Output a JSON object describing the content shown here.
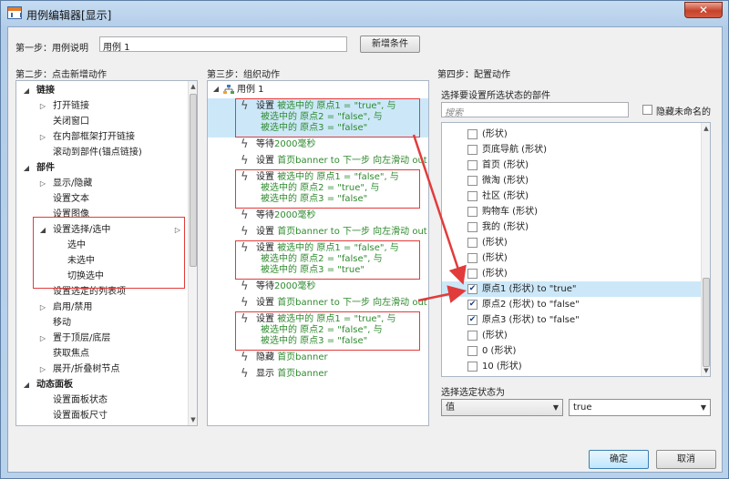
{
  "window": {
    "title": "用例编辑器[显示]",
    "close_glyph": "✕"
  },
  "step1": {
    "label": "第一步：用例说明",
    "case_name": "用例 1",
    "add_condition": "新增条件"
  },
  "step2": {
    "label": "第二步：点击新增动作",
    "items": [
      {
        "text": "链接",
        "kind": "group"
      },
      {
        "text": "打开链接",
        "kind": "child",
        "has_children": true
      },
      {
        "text": "关闭窗口",
        "kind": "child"
      },
      {
        "text": "在内部框架打开链接",
        "kind": "child",
        "has_children": true
      },
      {
        "text": "滚动到部件(锚点链接)",
        "kind": "child"
      },
      {
        "text": "部件",
        "kind": "group"
      },
      {
        "text": "显示/隐藏",
        "kind": "child",
        "has_children": true
      },
      {
        "text": "设置文本",
        "kind": "child"
      },
      {
        "text": "设置图像",
        "kind": "child"
      },
      {
        "text": "设置选择/选中",
        "kind": "child",
        "expanded": true
      },
      {
        "text": "选中",
        "kind": "grandchild"
      },
      {
        "text": "未选中",
        "kind": "grandchild"
      },
      {
        "text": "切换选中",
        "kind": "grandchild"
      },
      {
        "text": "设置选定的列表项",
        "kind": "child"
      },
      {
        "text": "启用/禁用",
        "kind": "child",
        "has_children": true
      },
      {
        "text": "移动",
        "kind": "child"
      },
      {
        "text": "置于顶层/底层",
        "kind": "child",
        "has_children": true
      },
      {
        "text": "获取焦点",
        "kind": "child"
      },
      {
        "text": "展开/折叠树节点",
        "kind": "child",
        "has_children": true
      },
      {
        "text": "动态面板",
        "kind": "group"
      },
      {
        "text": "设置面板状态",
        "kind": "child"
      },
      {
        "text": "设置面板尺寸",
        "kind": "child"
      }
    ]
  },
  "step3": {
    "label": "第三步：组织动作",
    "case_node": "用例 1",
    "actions": [
      {
        "lines": [
          [
            "设置 ",
            "被选中的 原点1 = \"true\", 与"
          ],
          [
            "",
            "被选中的 原点2 = \"false\", 与"
          ],
          [
            "",
            "被选中的 原点3 = \"false\""
          ]
        ],
        "selected": true
      },
      {
        "lines": [
          [
            "等待",
            "2000毫秒"
          ]
        ]
      },
      {
        "lines": [
          [
            "设置 ",
            "首页banner to 下一步 向左滑动 out 5("
          ]
        ]
      },
      {
        "lines": [
          [
            "设置 ",
            "被选中的 原点1 = \"false\", 与"
          ],
          [
            "",
            "被选中的 原点2 = \"true\", 与"
          ],
          [
            "",
            "被选中的 原点3 = \"false\""
          ]
        ]
      },
      {
        "lines": [
          [
            "等待",
            "2000毫秒"
          ]
        ]
      },
      {
        "lines": [
          [
            "设置 ",
            "首页banner to 下一步 向左滑动 out 5("
          ]
        ]
      },
      {
        "lines": [
          [
            "设置 ",
            "被选中的 原点1 = \"false\", 与"
          ],
          [
            "",
            "被选中的 原点2 = \"false\", 与"
          ],
          [
            "",
            "被选中的 原点3 = \"true\""
          ]
        ]
      },
      {
        "lines": [
          [
            "等待",
            "2000毫秒"
          ]
        ]
      },
      {
        "lines": [
          [
            "设置 ",
            "首页banner to 下一步 向左滑动 out 5("
          ]
        ]
      },
      {
        "lines": [
          [
            "设置 ",
            "被选中的 原点1 = \"true\", 与"
          ],
          [
            "",
            "被选中的 原点2 = \"false\", 与"
          ],
          [
            "",
            "被选中的 原点3 = \"false\""
          ]
        ]
      },
      {
        "lines": [
          [
            "隐藏 ",
            "首页banner"
          ]
        ]
      },
      {
        "lines": [
          [
            "显示 ",
            "首页banner"
          ]
        ]
      }
    ]
  },
  "step4": {
    "label": "第四步：配置动作",
    "select_widgets": "选择要设置所选状态的部件",
    "search_placeholder": "搜索",
    "hide_unnamed": "隐藏未命名的",
    "widgets": [
      {
        "text": "(形状)",
        "checked": false
      },
      {
        "text": "页底导航 (形状)",
        "checked": false
      },
      {
        "text": "首页 (形状)",
        "checked": false
      },
      {
        "text": "微淘 (形状)",
        "checked": false
      },
      {
        "text": "社区 (形状)",
        "checked": false
      },
      {
        "text": "购物车 (形状)",
        "checked": false
      },
      {
        "text": "我的 (形状)",
        "checked": false
      },
      {
        "text": "(形状)",
        "checked": false
      },
      {
        "text": "(形状)",
        "checked": false
      },
      {
        "text": "(形状)",
        "checked": false
      },
      {
        "text": "原点1 (形状) to \"true\"",
        "checked": true,
        "selected": true
      },
      {
        "text": "原点2 (形状) to \"false\"",
        "checked": true
      },
      {
        "text": "原点3 (形状) to \"false\"",
        "checked": true
      },
      {
        "text": "(形状)",
        "checked": false
      },
      {
        "text": "0 (形状)",
        "checked": false
      },
      {
        "text": "10 (形状)",
        "checked": false
      }
    ],
    "state_label": "选择选定状态为",
    "state_type": "值",
    "state_value": "true"
  },
  "footer": {
    "ok": "确定",
    "cancel": "取消"
  },
  "colors": {
    "highlight": "#cce8f8",
    "annotation": "#e23b3b",
    "action_text": "#2f8a2f"
  }
}
